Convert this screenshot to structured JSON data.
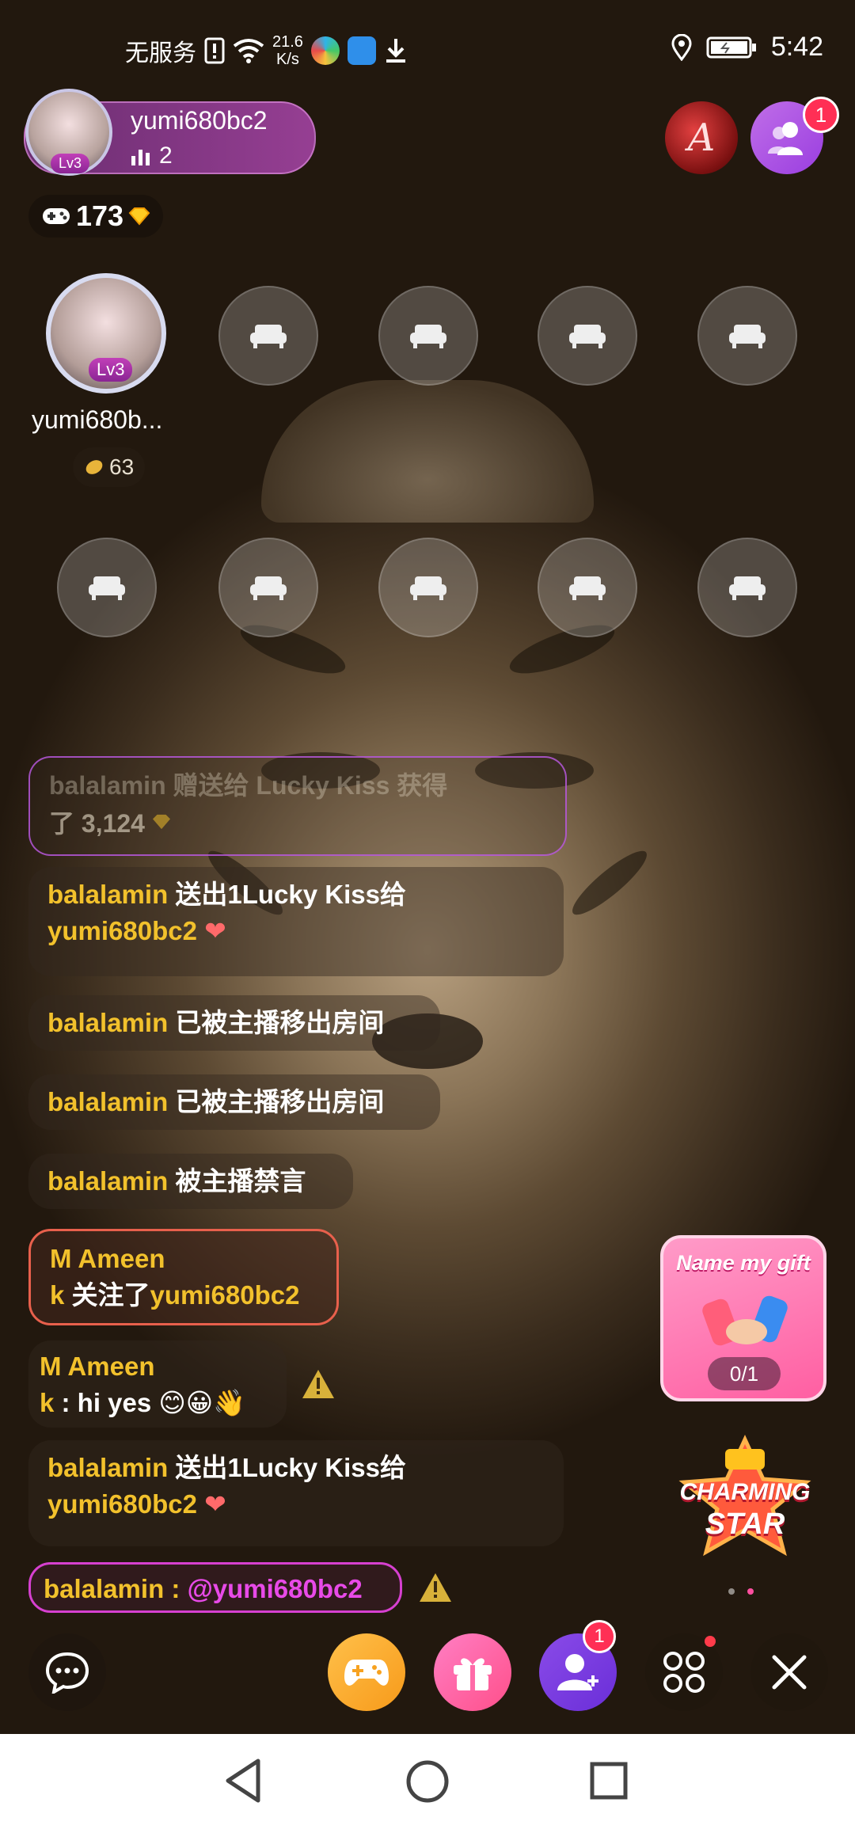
{
  "status_bar": {
    "carrier": "无服务",
    "speed_value": "21.6",
    "speed_unit": "K/s",
    "time": "5:42"
  },
  "host": {
    "name": "yumi680bc2",
    "level": "Lv3",
    "viewer_count": "2"
  },
  "coins": "173",
  "notifications": {
    "users_badge": "1",
    "invite_badge": "1"
  },
  "seat_host": {
    "name": "yumi680b...",
    "level": "Lv3",
    "score": "63"
  },
  "chat": {
    "ghost_line1": "balalamin 赠送给 Lucky Kiss 获得",
    "ghost_line2": "了 3,124",
    "m1_user": "balalamin",
    "m1_text": " 送出1Lucky Kiss给",
    "m1_target": "yumi680bc2",
    "m2_user": "balalamin",
    "m2_text": " 已被主播移出房间",
    "m3_user": "balalamin",
    "m3_text": " 已被主播移出房间",
    "m4_user": "balalamin",
    "m4_text": " 被主播禁言",
    "m5_user_a": "M Ameen",
    "m5_user_b": "k",
    "m5_text": " 关注了",
    "m5_target": "yumi680bc2",
    "m6_user_a": "M Ameen",
    "m6_user_b": "k",
    "m6_text": " : hi yes 😊😀👋",
    "m7_user": "balalamin",
    "m7_text": " 送出1Lucky Kiss给",
    "m7_target": "yumi680bc2",
    "m8_user": "balalamin : ",
    "m8_mention": "@yumi680bc2"
  },
  "gift_card": {
    "title": "Name my gift",
    "progress": "0/1"
  },
  "charming_star": {
    "line1": "CHARMING",
    "line2": "STAR"
  },
  "colors": {
    "gold": "#f2c12c",
    "pink": "#ff4fa0",
    "purple": "#9a3ee0"
  }
}
